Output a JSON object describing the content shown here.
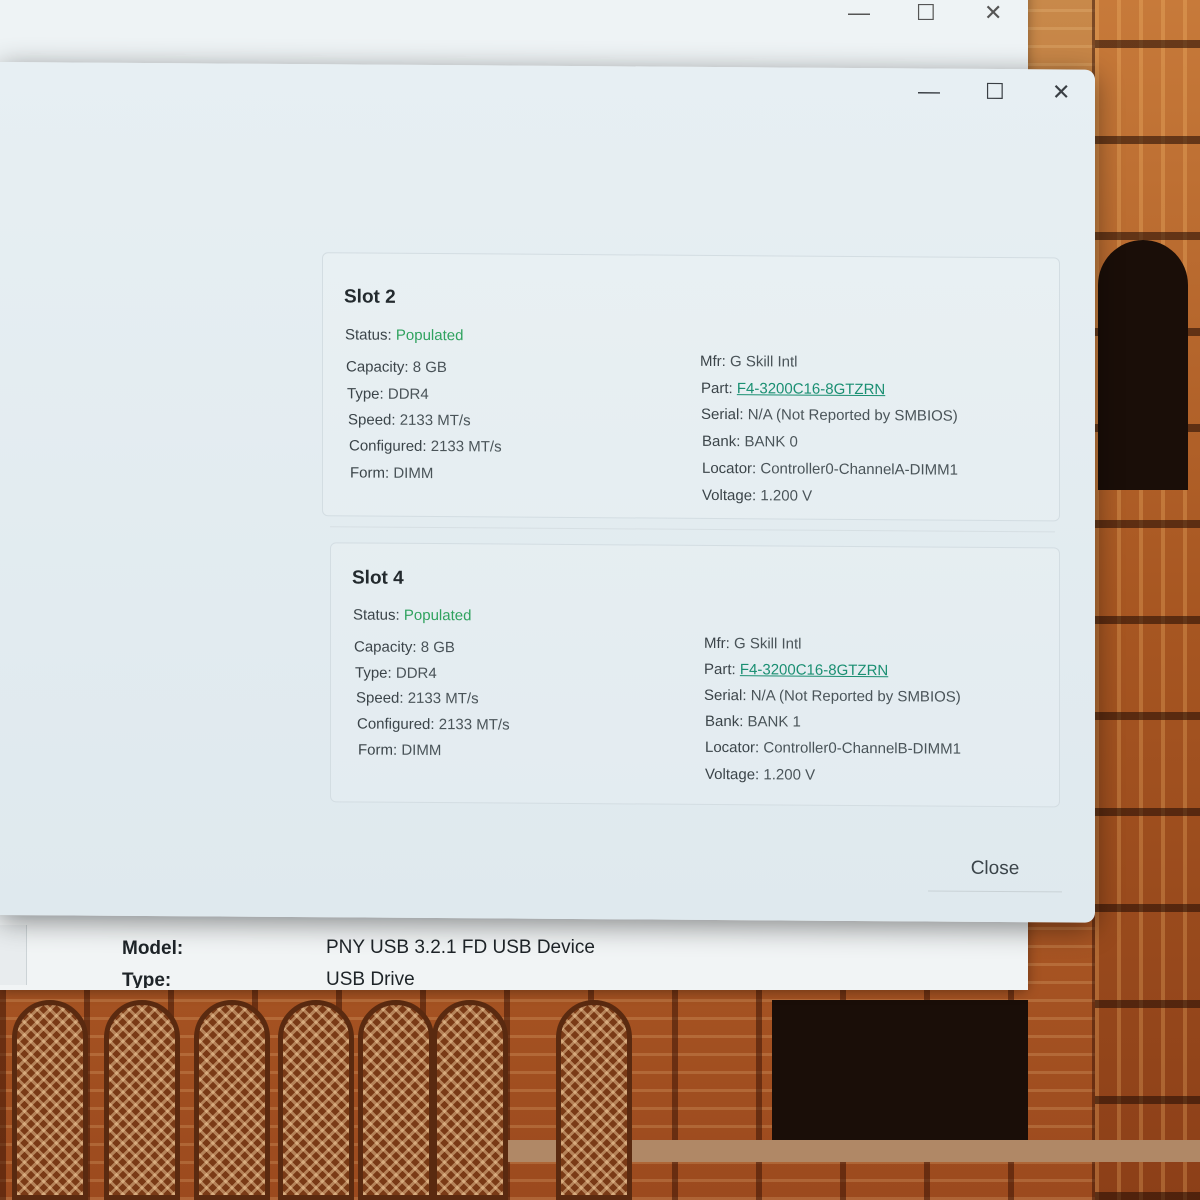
{
  "back_window": {
    "controls": {
      "minimize": "—",
      "maximize": "☐",
      "close": "✕"
    },
    "rows": [
      {
        "label": "Model:",
        "value": "PNY USB 3.2.1 FD USB Device"
      },
      {
        "label": "Type:",
        "value": "USB Drive"
      }
    ]
  },
  "dialog": {
    "controls": {
      "minimize": "—",
      "maximize": "☐",
      "close": "✕"
    },
    "slots": [
      {
        "title": "Slot 2",
        "status_label": "Status:",
        "status_value": "Populated",
        "capacity_label": "Capacity:",
        "capacity_value": "8 GB",
        "type_label": "Type:",
        "type_value": "DDR4",
        "speed_label": "Speed:",
        "speed_value": "2133 MT/s",
        "configured_label": "Configured:",
        "configured_value": "2133 MT/s",
        "form_label": "Form:",
        "form_value": "DIMM",
        "mfr_label": "Mfr:",
        "mfr_value": "G Skill Intl",
        "part_label": "Part:",
        "part_value": "F4-3200C16-8GTZRN",
        "serial_label": "Serial:",
        "serial_value": "N/A (Not Reported by SMBIOS)",
        "bank_label": "Bank:",
        "bank_value": "BANK 0",
        "locator_label": "Locator:",
        "locator_value": "Controller0-ChannelA-DIMM1",
        "voltage_label": "Voltage:",
        "voltage_value": "1.200 V"
      },
      {
        "title": "Slot 4",
        "status_label": "Status:",
        "status_value": "Populated",
        "capacity_label": "Capacity:",
        "capacity_value": "8 GB",
        "type_label": "Type:",
        "type_value": "DDR4",
        "speed_label": "Speed:",
        "speed_value": "2133 MT/s",
        "configured_label": "Configured:",
        "configured_value": "2133 MT/s",
        "form_label": "Form:",
        "form_value": "DIMM",
        "mfr_label": "Mfr:",
        "mfr_value": "G Skill Intl",
        "part_label": "Part:",
        "part_value": "F4-3200C16-8GTZRN",
        "serial_label": "Serial:",
        "serial_value": "N/A (Not Reported by SMBIOS)",
        "bank_label": "Bank:",
        "bank_value": "BANK 1",
        "locator_label": "Locator:",
        "locator_value": "Controller0-ChannelB-DIMM1",
        "voltage_label": "Voltage:",
        "voltage_value": "1.200 V"
      }
    ],
    "close_label": "Close"
  },
  "colors": {
    "status_ok": "#2fa25e",
    "link": "#1a8f72"
  }
}
